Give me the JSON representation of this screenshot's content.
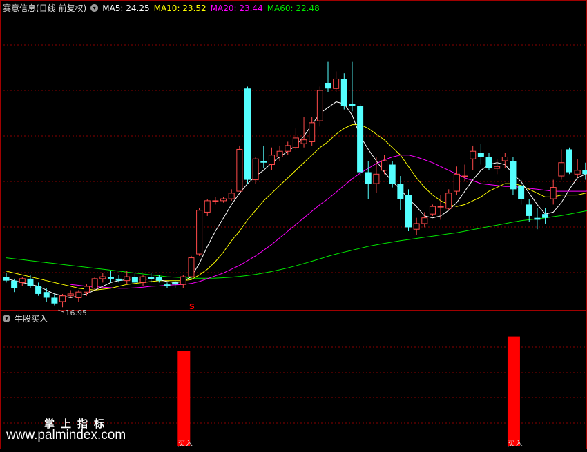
{
  "header": {
    "title": "赛意信息(日线 前复权)",
    "ma_items": [
      {
        "label": "MA5: 24.25",
        "color": "#ffffff"
      },
      {
        "label": "MA10: 23.52",
        "color": "#ffff00"
      },
      {
        "label": "MA20: 23.44",
        "color": "#ff00ff"
      },
      {
        "label": "MA60: 22.48",
        "color": "#00e600"
      }
    ]
  },
  "indicator": {
    "title": "牛股买入"
  },
  "watermark": {
    "chinese": "掌上指标",
    "url": "www.palmindex.com"
  },
  "colors": {
    "up": "#ff4a4a",
    "down": "#54ffff",
    "ma5": "#ffffff",
    "ma10": "#ffff00",
    "ma20": "#ff00ff",
    "ma60": "#00e600",
    "grid": "#8b0000",
    "signal": "#ff0000"
  },
  "chart_data": [
    {
      "type": "candlestick",
      "ylim": [
        16.2,
        31.8
      ],
      "low_annotation": {
        "index": 7,
        "label": "16.95"
      },
      "marker": {
        "index": 23,
        "label": "S"
      },
      "candles": [
        [
          17.9,
          18.1,
          17.6,
          17.7
        ],
        [
          17.7,
          17.8,
          17.1,
          17.3
        ],
        [
          17.6,
          17.9,
          17.4,
          17.8
        ],
        [
          17.8,
          18.0,
          17.3,
          17.4
        ],
        [
          17.4,
          17.6,
          16.9,
          17.0
        ],
        [
          17.1,
          17.3,
          16.6,
          16.8
        ],
        [
          16.8,
          17.0,
          16.4,
          16.5
        ],
        [
          16.6,
          17.0,
          16.3,
          16.9
        ],
        [
          16.9,
          17.2,
          16.8,
          17.0
        ],
        [
          16.8,
          17.2,
          16.6,
          17.1
        ],
        [
          17.1,
          17.5,
          16.9,
          17.4
        ],
        [
          17.3,
          17.9,
          17.2,
          17.8
        ],
        [
          17.8,
          18.1,
          17.6,
          17.9
        ],
        [
          17.9,
          18.2,
          17.6,
          17.8
        ],
        [
          17.8,
          18.0,
          17.6,
          17.7
        ],
        [
          17.7,
          18.2,
          17.5,
          17.9
        ],
        [
          17.9,
          18.1,
          17.5,
          17.6
        ],
        [
          17.6,
          18.0,
          17.4,
          17.9
        ],
        [
          17.9,
          18.1,
          17.6,
          17.8
        ],
        [
          17.9,
          18.0,
          17.6,
          17.7
        ],
        [
          17.5,
          17.6,
          17.3,
          17.4
        ],
        [
          17.6,
          17.7,
          17.3,
          17.5
        ],
        [
          17.5,
          18.0,
          17.3,
          17.9
        ],
        [
          17.9,
          19.0,
          17.8,
          18.9
        ],
        [
          19.1,
          21.5,
          19.0,
          21.4
        ],
        [
          21.3,
          22.0,
          21.1,
          21.9
        ],
        [
          21.9,
          22.1,
          21.7,
          21.9
        ],
        [
          21.9,
          22.1,
          21.8,
          22.0
        ],
        [
          22.0,
          22.5,
          21.9,
          22.3
        ],
        [
          22.4,
          24.8,
          22.4,
          24.6
        ],
        [
          27.8,
          27.9,
          22.8,
          23.0
        ],
        [
          23.0,
          24.2,
          22.8,
          24.1
        ],
        [
          24.0,
          24.8,
          23.6,
          23.9
        ],
        [
          23.8,
          24.7,
          23.5,
          24.3
        ],
        [
          24.2,
          24.8,
          24.0,
          24.5
        ],
        [
          24.5,
          25.0,
          24.3,
          24.8
        ],
        [
          24.7,
          25.7,
          24.6,
          25.2
        ],
        [
          24.9,
          26.3,
          24.7,
          25.1
        ],
        [
          25.0,
          26.3,
          24.8,
          26.0
        ],
        [
          26.1,
          27.9,
          25.8,
          27.7
        ],
        [
          28.1,
          29.2,
          27.6,
          27.8
        ],
        [
          27.8,
          28.7,
          27.6,
          28.3
        ],
        [
          28.3,
          28.6,
          26.7,
          26.9
        ],
        [
          27.0,
          29.2,
          26.6,
          26.9
        ],
        [
          26.9,
          27.0,
          23.2,
          23.4
        ],
        [
          23.4,
          24.0,
          22.0,
          22.8
        ],
        [
          22.8,
          24.2,
          22.3,
          23.3
        ],
        [
          23.5,
          24.3,
          23.3,
          24.0
        ],
        [
          23.8,
          24.0,
          22.6,
          22.8
        ],
        [
          22.8,
          23.2,
          21.4,
          22.0
        ],
        [
          22.2,
          22.5,
          20.3,
          20.5
        ],
        [
          20.4,
          21.0,
          20.1,
          20.7
        ],
        [
          20.7,
          21.3,
          20.5,
          21.0
        ],
        [
          21.2,
          21.7,
          21.1,
          21.6
        ],
        [
          21.6,
          22.2,
          20.9,
          21.6
        ],
        [
          21.5,
          22.5,
          21.4,
          22.3
        ],
        [
          22.4,
          23.7,
          22.2,
          23.3
        ],
        [
          23.2,
          23.8,
          22.9,
          23.2
        ],
        [
          24.1,
          24.8,
          23.5,
          24.5
        ],
        [
          24.4,
          24.9,
          23.8,
          24.2
        ],
        [
          24.2,
          24.4,
          23.5,
          23.6
        ],
        [
          23.6,
          24.1,
          23.3,
          23.7
        ],
        [
          24.0,
          24.4,
          23.6,
          24.2
        ],
        [
          24.0,
          24.2,
          22.2,
          22.5
        ],
        [
          22.7,
          23.0,
          21.7,
          22.0
        ],
        [
          21.7,
          22.0,
          20.8,
          21.1
        ],
        [
          21.0,
          21.5,
          20.4,
          20.9
        ],
        [
          21.2,
          21.5,
          20.7,
          21.0
        ],
        [
          22.0,
          23.0,
          21.7,
          22.6
        ],
        [
          23.2,
          24.6,
          23.0,
          23.9
        ],
        [
          24.6,
          24.7,
          23.3,
          23.4
        ],
        [
          23.3,
          24.1,
          23.1,
          23.5
        ],
        [
          23.5,
          23.9,
          23.0,
          23.3
        ],
        [
          23.3,
          23.5,
          22.0,
          22.9
        ],
        [
          23.1,
          24.1,
          22.9,
          23.8
        ],
        [
          23.7,
          25.3,
          23.3,
          24.2
        ],
        [
          24.1,
          24.3,
          23.5,
          23.6
        ],
        [
          23.9,
          25.1,
          23.2,
          24.6
        ]
      ],
      "ma5": [
        17.8,
        17.7,
        17.6,
        17.5,
        17.4,
        17.2,
        17.0,
        16.9,
        16.8,
        16.9,
        17.0,
        17.2,
        17.4,
        17.6,
        17.7,
        17.75,
        17.8,
        17.75,
        17.8,
        17.75,
        17.65,
        17.6,
        17.65,
        17.9,
        18.6,
        19.5,
        20.3,
        21.0,
        21.7,
        22.3,
        22.8,
        23.2,
        23.5,
        23.9,
        24.2,
        24.5,
        24.8,
        25.3,
        25.9,
        26.5,
        26.8,
        27.1,
        27.0,
        26.4,
        25.3,
        24.6,
        24.0,
        23.4,
        22.9,
        22.5,
        22.0,
        21.6,
        21.1,
        21.0,
        21.1,
        21.4,
        21.8,
        22.4,
        23.0,
        23.5,
        23.8,
        23.9,
        23.8,
        23.3,
        22.9,
        22.3,
        21.7,
        21.2,
        21.3,
        21.8,
        22.5,
        23.1,
        23.3,
        23.4,
        23.5,
        23.6,
        23.7,
        24.0
      ],
      "ma10": [
        18.2,
        18.1,
        18.0,
        17.9,
        17.8,
        17.7,
        17.6,
        17.5,
        17.4,
        17.3,
        17.25,
        17.2,
        17.25,
        17.3,
        17.4,
        17.5,
        17.55,
        17.6,
        17.65,
        17.7,
        17.7,
        17.7,
        17.7,
        17.75,
        18.0,
        18.3,
        18.7,
        19.2,
        19.8,
        20.3,
        20.9,
        21.4,
        21.9,
        22.3,
        22.7,
        23.1,
        23.5,
        23.9,
        24.3,
        24.7,
        25.0,
        25.4,
        25.7,
        25.9,
        25.9,
        25.7,
        25.4,
        25.1,
        24.7,
        24.3,
        23.7,
        23.1,
        22.6,
        22.2,
        21.9,
        21.7,
        21.6,
        21.7,
        21.9,
        22.1,
        22.4,
        22.6,
        22.8,
        22.8,
        22.7,
        22.5,
        22.3,
        22.1,
        22.1,
        22.2,
        22.2,
        22.2,
        22.3,
        22.4,
        22.6,
        22.7,
        22.9,
        23.1
      ],
      "ma20": [
        null,
        null,
        null,
        null,
        null,
        null,
        null,
        null,
        17.5,
        17.45,
        17.4,
        17.38,
        17.35,
        17.33,
        17.3,
        17.3,
        17.32,
        17.35,
        17.4,
        17.42,
        17.45,
        17.48,
        17.5,
        17.55,
        17.65,
        17.8,
        17.95,
        18.1,
        18.3,
        18.5,
        18.75,
        19.0,
        19.3,
        19.6,
        19.95,
        20.3,
        20.65,
        21.0,
        21.35,
        21.7,
        22.0,
        22.35,
        22.7,
        23.05,
        23.35,
        23.6,
        23.85,
        24.05,
        24.2,
        24.3,
        24.3,
        24.2,
        24.05,
        23.9,
        23.7,
        23.5,
        23.3,
        23.1,
        22.95,
        22.8,
        22.75,
        22.7,
        22.65,
        22.65,
        22.6,
        22.55,
        22.5,
        22.45,
        22.4,
        22.4,
        22.4,
        22.4,
        22.4,
        22.45,
        22.5,
        22.55,
        22.6,
        22.7
      ],
      "ma60": [
        18.9,
        18.85,
        18.8,
        18.75,
        18.7,
        18.65,
        18.6,
        18.55,
        18.5,
        18.45,
        18.4,
        18.35,
        18.3,
        18.25,
        18.2,
        18.15,
        18.1,
        18.05,
        18.0,
        17.95,
        17.9,
        17.88,
        17.85,
        17.83,
        17.82,
        17.82,
        17.83,
        17.85,
        17.88,
        17.92,
        17.97,
        18.03,
        18.1,
        18.18,
        18.27,
        18.37,
        18.48,
        18.6,
        18.72,
        18.85,
        18.98,
        19.1,
        19.2,
        19.3,
        19.4,
        19.5,
        19.58,
        19.66,
        19.73,
        19.8,
        19.86,
        19.92,
        19.98,
        20.04,
        20.1,
        20.16,
        20.22,
        20.3,
        20.38,
        20.46,
        20.54,
        20.62,
        20.7,
        20.78,
        20.85,
        20.9,
        20.95,
        21.0,
        21.06,
        21.12,
        21.2,
        21.28,
        21.36,
        21.44,
        21.52,
        21.6,
        21.7,
        21.8
      ]
    },
    {
      "type": "bar",
      "title": "牛股买入",
      "ylim": [
        0,
        1
      ],
      "signals": [
        {
          "index": 22,
          "value": 0.78,
          "label": "买入"
        },
        {
          "index": 63,
          "value": 0.9,
          "label": "买入"
        }
      ]
    }
  ]
}
